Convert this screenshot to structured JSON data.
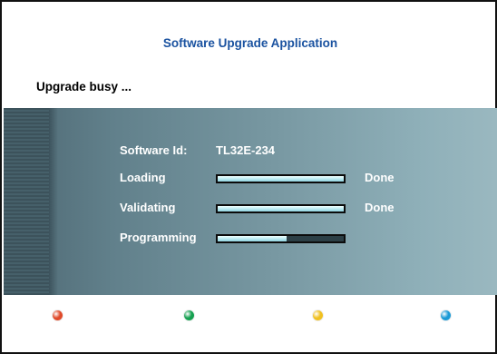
{
  "app": {
    "title": "Software Upgrade Application",
    "status": "Upgrade busy ..."
  },
  "info": {
    "software_id_label": "Software Id:",
    "software_id_value": "TL32E-234"
  },
  "steps": [
    {
      "label": "Loading",
      "progress": 1.0,
      "status": "Done"
    },
    {
      "label": "Validating",
      "progress": 1.0,
      "status": "Done"
    },
    {
      "label": "Programming",
      "progress": 0.55,
      "status": ""
    }
  ],
  "color_keys": [
    {
      "name": "red-key",
      "color": "#e04a2a"
    },
    {
      "name": "green-key",
      "color": "#15a050"
    },
    {
      "name": "yellow-key",
      "color": "#f0c020"
    },
    {
      "name": "blue-key",
      "color": "#1b9ad6"
    }
  ],
  "colors": {
    "title_blue": "#1a52a0",
    "panel_dark": "#4d6772",
    "panel_light": "#9ab8c0",
    "bar_fill": "#c2eef4"
  }
}
